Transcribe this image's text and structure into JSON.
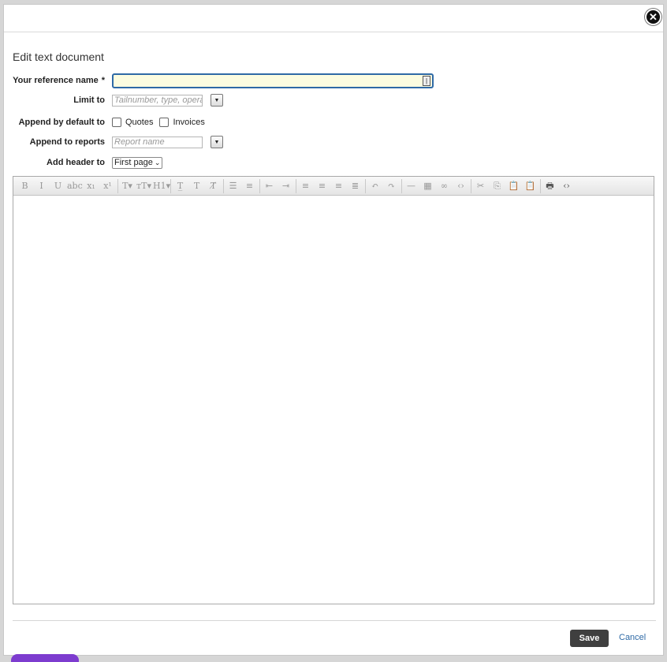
{
  "dialog": {
    "title": "Edit text document",
    "close_icon": "close-icon",
    "close_glyph": "✕"
  },
  "form": {
    "reference_name": {
      "label": "Your reference name",
      "required_mark": "*",
      "value": ""
    },
    "limit_to": {
      "label": "Limit to",
      "placeholder": "Tailnumber, type, opera",
      "dropdown_glyph": "▼"
    },
    "append_default": {
      "label": "Append by default to",
      "options": [
        {
          "label": "Quotes",
          "checked": false
        },
        {
          "label": "Invoices",
          "checked": false
        }
      ]
    },
    "append_reports": {
      "label": "Append to reports",
      "placeholder": "Report name",
      "dropdown_glyph": "▼"
    },
    "add_header": {
      "label": "Add header to",
      "selected": "First page"
    }
  },
  "toolbar": {
    "buttons": [
      {
        "glyph": "B",
        "name": "bold-icon"
      },
      {
        "glyph": "I",
        "name": "italic-icon"
      },
      {
        "glyph": "U",
        "name": "underline-icon"
      },
      {
        "glyph": "abc",
        "name": "strikethrough-icon"
      },
      {
        "glyph": "x₁",
        "name": "subscript-icon"
      },
      {
        "glyph": "x¹",
        "name": "superscript-icon"
      },
      {
        "glyph": "T▾",
        "name": "font-icon"
      },
      {
        "glyph": "тT▾",
        "name": "font-size-icon"
      },
      {
        "glyph": "H1▾",
        "name": "heading-icon"
      },
      {
        "glyph": "T̲",
        "name": "format-icon"
      },
      {
        "glyph": "T",
        "name": "highlight-icon"
      },
      {
        "glyph": "T̸",
        "name": "clear-format-icon"
      },
      {
        "glyph": "☰",
        "name": "bullet-list-icon"
      },
      {
        "glyph": "≡",
        "name": "numbered-list-icon"
      },
      {
        "glyph": "⇤",
        "name": "outdent-icon"
      },
      {
        "glyph": "⇥",
        "name": "indent-icon"
      },
      {
        "glyph": "≡",
        "name": "align-left-icon"
      },
      {
        "glyph": "≡",
        "name": "align-center-icon"
      },
      {
        "glyph": "≡",
        "name": "align-right-icon"
      },
      {
        "glyph": "≣",
        "name": "align-justify-icon"
      },
      {
        "glyph": "↶",
        "name": "undo-icon"
      },
      {
        "glyph": "↷",
        "name": "redo-icon"
      },
      {
        "glyph": "—",
        "name": "horizontal-rule-icon"
      },
      {
        "glyph": "▦",
        "name": "table-icon"
      },
      {
        "glyph": "∞",
        "name": "link-icon"
      },
      {
        "glyph": "‹›",
        "name": "unlink-icon"
      },
      {
        "glyph": "✂",
        "name": "cut-icon"
      },
      {
        "glyph": "⎘",
        "name": "copy-icon"
      },
      {
        "glyph": "📋",
        "name": "paste-icon"
      },
      {
        "glyph": "📋",
        "name": "paste-text-icon"
      },
      {
        "glyph": "🖶",
        "name": "print-icon"
      },
      {
        "glyph": "‹›",
        "name": "source-icon"
      }
    ]
  },
  "footer": {
    "save_label": "Save",
    "cancel_label": "Cancel"
  }
}
